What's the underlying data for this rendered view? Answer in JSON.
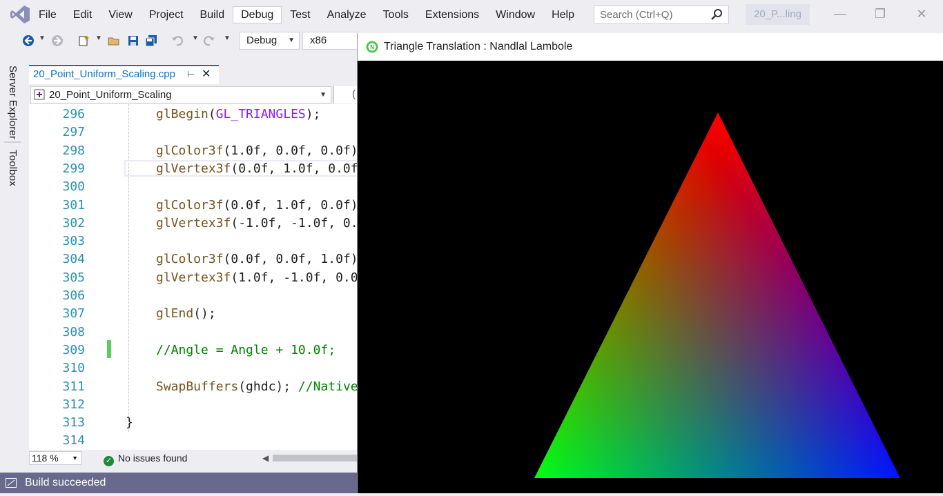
{
  "menubar": {
    "items": [
      "File",
      "Edit",
      "View",
      "Project",
      "Build",
      "Debug",
      "Test",
      "Analyze",
      "Tools",
      "Extensions",
      "Window",
      "Help"
    ],
    "active_index": 5,
    "search_placeholder": "Search (Ctrl+Q)",
    "solution_name": "20_P...ling"
  },
  "toolbar": {
    "configuration": "Debug",
    "platform": "x86"
  },
  "leftrail": {
    "server_explorer": "Server Explorer",
    "toolbox": "Toolbox"
  },
  "editor": {
    "tab_name": "20_Point_Uniform_Scaling.cpp",
    "nav_scope": "20_Point_Uniform_Scaling",
    "nav_scope2": "(",
    "lines": [
      {
        "num": "296",
        "text": "glBegin(GL_TRIANGLES);"
      },
      {
        "num": "297",
        "text": ""
      },
      {
        "num": "298",
        "text": "glColor3f(1.0f, 0.0f, 0.0f)"
      },
      {
        "num": "299",
        "text": "glVertex3f(0.0f, 1.0f, 0.0f"
      },
      {
        "num": "300",
        "text": ""
      },
      {
        "num": "301",
        "text": "glColor3f(0.0f, 1.0f, 0.0f)"
      },
      {
        "num": "302",
        "text": "glVertex3f(-1.0f, -1.0f, 0."
      },
      {
        "num": "303",
        "text": ""
      },
      {
        "num": "304",
        "text": "glColor3f(0.0f, 0.0f, 1.0f)"
      },
      {
        "num": "305",
        "text": "glVertex3f(1.0f, -1.0f, 0.0"
      },
      {
        "num": "306",
        "text": ""
      },
      {
        "num": "307",
        "text": "glEnd();"
      },
      {
        "num": "308",
        "text": ""
      },
      {
        "num": "309",
        "text": "//Angle = Angle + 10.0f;"
      },
      {
        "num": "310",
        "text": ""
      },
      {
        "num": "311",
        "text": "SwapBuffers(ghdc); //Native"
      },
      {
        "num": "312",
        "text": ""
      },
      {
        "num": "313",
        "text": "}"
      },
      {
        "num": "314",
        "text": ""
      }
    ]
  },
  "statusstrip": {
    "zoom": "118 %",
    "issues": "No issues found"
  },
  "statusbar": {
    "text": "Build succeeded"
  },
  "glwindow": {
    "title": "Triangle Translation : Nandlal Lambole",
    "vertex_colors": [
      "#ff0000",
      "#00ff00",
      "#0000ff"
    ],
    "background": "#000000"
  }
}
